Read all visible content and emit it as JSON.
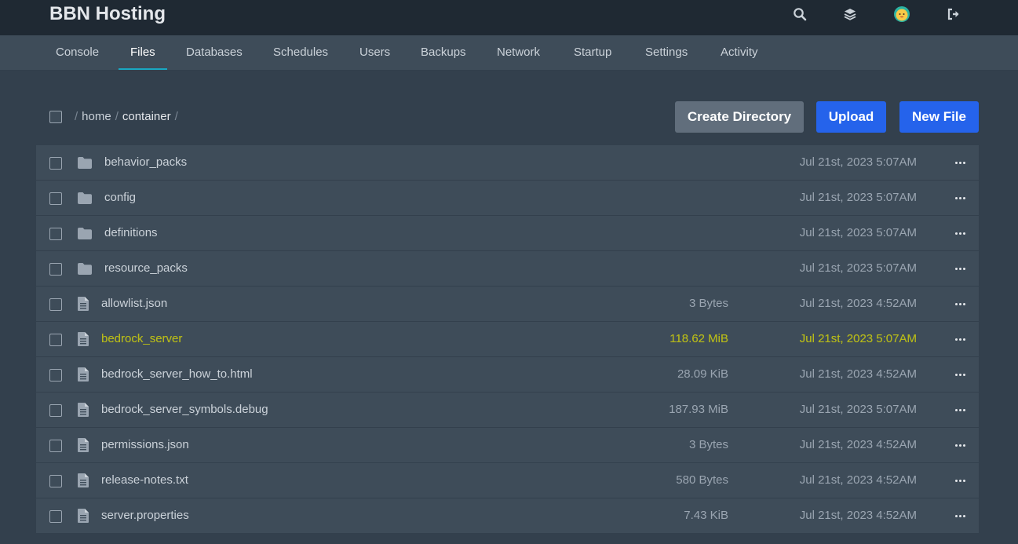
{
  "app": {
    "title": "BBN Hosting"
  },
  "top_icons": [
    {
      "name": "search-icon"
    },
    {
      "name": "layers-icon"
    },
    {
      "name": "avatar"
    },
    {
      "name": "logout-icon"
    }
  ],
  "tabs": [
    {
      "label": "Console"
    },
    {
      "label": "Files",
      "active": true
    },
    {
      "label": "Databases"
    },
    {
      "label": "Schedules"
    },
    {
      "label": "Users"
    },
    {
      "label": "Backups"
    },
    {
      "label": "Network"
    },
    {
      "label": "Startup"
    },
    {
      "label": "Settings"
    },
    {
      "label": "Activity"
    }
  ],
  "breadcrumb": {
    "root": "/",
    "segments": [
      "home",
      "container"
    ],
    "separator": "/"
  },
  "actions": {
    "create_directory": "Create Directory",
    "upload": "Upload",
    "new_file": "New File"
  },
  "files": [
    {
      "name": "behavior_packs",
      "type": "folder",
      "size": "",
      "date": "Jul 21st, 2023 5:07AM"
    },
    {
      "name": "config",
      "type": "folder",
      "size": "",
      "date": "Jul 21st, 2023 5:07AM"
    },
    {
      "name": "definitions",
      "type": "folder",
      "size": "",
      "date": "Jul 21st, 2023 5:07AM"
    },
    {
      "name": "resource_packs",
      "type": "folder",
      "size": "",
      "date": "Jul 21st, 2023 5:07AM"
    },
    {
      "name": "allowlist.json",
      "type": "file",
      "size": "3 Bytes",
      "date": "Jul 21st, 2023 4:52AM"
    },
    {
      "name": "bedrock_server",
      "type": "file",
      "size": "118.62 MiB",
      "date": "Jul 21st, 2023 5:07AM",
      "highlighted": true
    },
    {
      "name": "bedrock_server_how_to.html",
      "type": "file",
      "size": "28.09 KiB",
      "date": "Jul 21st, 2023 4:52AM"
    },
    {
      "name": "bedrock_server_symbols.debug",
      "type": "file",
      "size": "187.93 MiB",
      "date": "Jul 21st, 2023 5:07AM"
    },
    {
      "name": "permissions.json",
      "type": "file",
      "size": "3 Bytes",
      "date": "Jul 21st, 2023 4:52AM"
    },
    {
      "name": "release-notes.txt",
      "type": "file",
      "size": "580 Bytes",
      "date": "Jul 21st, 2023 4:52AM"
    },
    {
      "name": "server.properties",
      "type": "file",
      "size": "7.43 KiB",
      "date": "Jul 21st, 2023 4:52AM"
    }
  ],
  "colors": {
    "background": "#33404d",
    "topbar": "#1f2933",
    "subnav": "#3e4c59",
    "active_tab_underline": "#19a8c2",
    "primary_button": "#2563eb",
    "secondary_button": "#616e7c",
    "highlight_marker": "#3f4a00",
    "highlight_text": "#b5b81a"
  }
}
